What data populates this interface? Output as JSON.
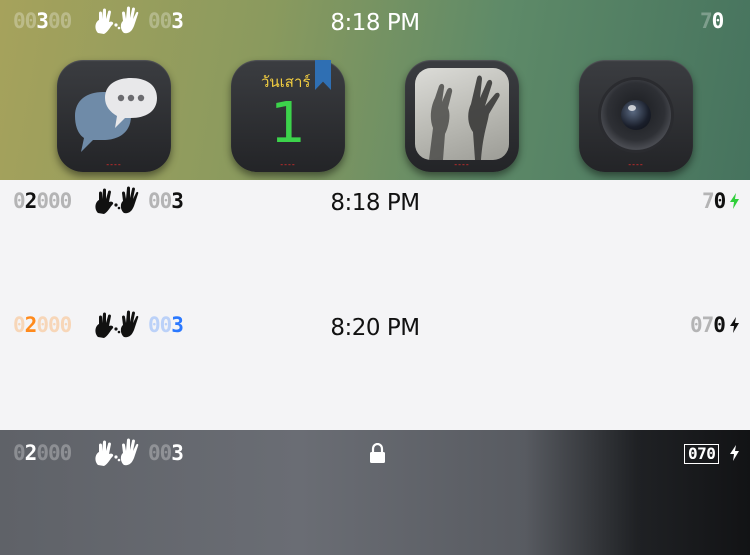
{
  "statusbars": [
    {
      "carrier_dim": "00",
      "carrier_lit": "3",
      "carrier_dim2": "00",
      "signal_dim": "00",
      "signal_lit": "3",
      "time": "8:18 PM",
      "battery_dim": "7",
      "battery_lit": "0",
      "text_color": "#ffffff"
    },
    {
      "carrier_dim": "0",
      "carrier_lit": "2",
      "carrier_dim2": "000",
      "signal_dim": "00",
      "signal_lit": "3",
      "time": "8:18 PM",
      "battery_dim": "7",
      "battery_lit": "0",
      "text_color": "#111111",
      "charge_color": "#2fcf3a"
    },
    {
      "carrier_dim": "0",
      "carrier_lit": "2",
      "carrier_dim2": "000",
      "signal_dim": "00",
      "signal_lit": "3",
      "time": "8:20 PM",
      "battery_dim": "07",
      "battery_lit": "0",
      "text_color": "#111111",
      "carrier_color": "#ff8a1c",
      "signal_color": "#2a78ff"
    },
    {
      "carrier_dim": "0",
      "carrier_lit": "2",
      "carrier_dim2": "000",
      "signal_dim": "00",
      "signal_lit": "3",
      "battery_text": "070",
      "text_color": "#ffffff"
    }
  ],
  "dock": {
    "apps": [
      {
        "name": "Messages",
        "icon": "chat-bubbles-icon"
      },
      {
        "name": "Calendar",
        "icon": "calendar-icon",
        "day_label": "วันเสาร์",
        "day_number": "1"
      },
      {
        "name": "Photos",
        "icon": "photo-hands-icon"
      },
      {
        "name": "Camera",
        "icon": "camera-lens-icon"
      }
    ],
    "badge_dots": "----"
  },
  "colors": {
    "lock": "#ffffff",
    "charge_bolt_dark": "#111111"
  }
}
